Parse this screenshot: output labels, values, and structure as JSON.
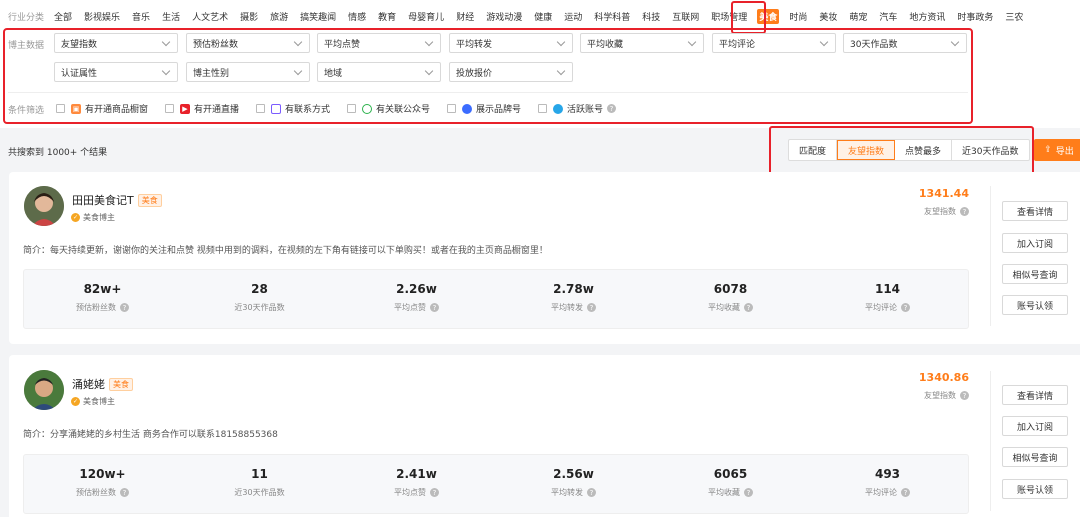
{
  "categories": {
    "label": "行业分类",
    "items": [
      "全部",
      "影视娱乐",
      "音乐",
      "生活",
      "人文艺术",
      "摄影",
      "旅游",
      "搞笑趣闻",
      "情感",
      "教育",
      "母婴育儿",
      "财经",
      "游戏动漫",
      "健康",
      "运动",
      "科学科普",
      "科技",
      "互联网",
      "职场管理",
      "美食",
      "时尚",
      "美妆",
      "萌宠",
      "汽车",
      "地方资讯",
      "时事政务",
      "三农"
    ],
    "active": "美食"
  },
  "filters": {
    "label": "博主数据",
    "row1": [
      "友望指数",
      "预估粉丝数",
      "平均点赞",
      "平均转发",
      "平均收藏",
      "平均评论",
      "30天作品数"
    ],
    "row2": [
      "认证属性",
      "博主性别",
      "地域",
      "投放报价"
    ],
    "conditions_label": "条件筛选",
    "conditions": [
      "有开通商品橱窗",
      "有开通直播",
      "有联系方式",
      "有关联公众号",
      "展示品牌号",
      "活跃账号"
    ]
  },
  "results": {
    "count_text": "共搜索到 1000+ 个结果",
    "sort_tabs": [
      "匹配度",
      "友望指数",
      "点赞最多",
      "近30天作品数"
    ],
    "active_sort": "友望指数",
    "export_label": "导出"
  },
  "actions": [
    "查看详情",
    "加入订阅",
    "相似号查询",
    "账号认领"
  ],
  "stat_labels": [
    "预估粉丝数",
    "近30天作品数",
    "平均点赞",
    "平均转发",
    "平均收藏",
    "平均评论"
  ],
  "score_label": "友望指数",
  "cards": [
    {
      "name": "田田美食记T",
      "tag": "美食",
      "type": "美食博主",
      "bio": "简介：每天持续更新，谢谢你的关注和点赞 视频中用到的调料，在视频的左下角有链接可以下单购买！或者在我的主页商品橱窗里！",
      "score": "1341.44",
      "stats": [
        "82w+",
        "28",
        "2.26w",
        "2.78w",
        "6078",
        "114"
      ]
    },
    {
      "name": "涌姥姥",
      "tag": "美食",
      "type": "美食博主",
      "bio": "简介：分享涌姥姥的乡村生活 商务合作可以联系18158855368",
      "score": "1340.86",
      "stats": [
        "120w+",
        "11",
        "2.41w",
        "2.56w",
        "6065",
        "493"
      ]
    }
  ],
  "colors": {
    "accent": "#ff7d1a",
    "highlight": "#e8212a"
  }
}
